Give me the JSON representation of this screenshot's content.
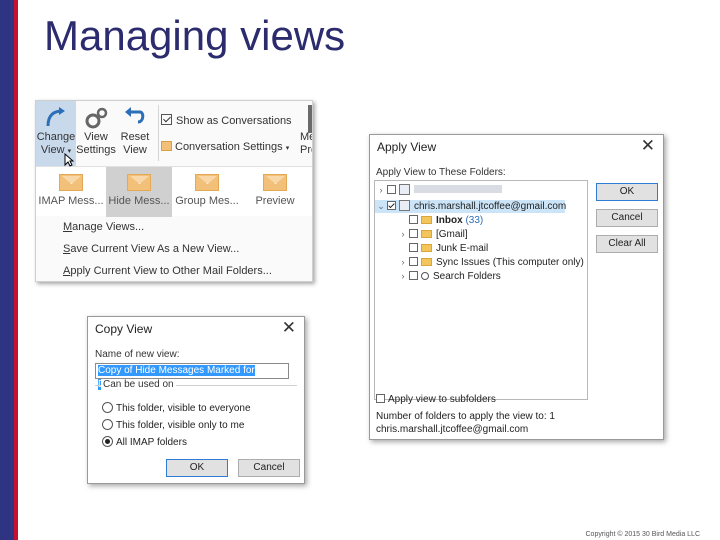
{
  "slide": {
    "title": "Managing views",
    "copyright": "Copyright © 2015 30 Bird Media LLC"
  },
  "ribbon": {
    "buttons": [
      {
        "label_line1": "Change",
        "label_line2": "View",
        "icon": "change-view-icon"
      },
      {
        "label_line1": "View",
        "label_line2": "Settings",
        "icon": "view-settings-icon"
      },
      {
        "label_line1": "Reset",
        "label_line2": "View",
        "icon": "reset-view-icon"
      }
    ],
    "show_as_conversations": "Show as Conversations",
    "conversation_settings": "Conversation Settings",
    "more_line1": "Me",
    "more_line2": "Pre",
    "gallery": [
      {
        "label": "IMAP Mess...",
        "active": false
      },
      {
        "label": "Hide Mess...",
        "active": true
      },
      {
        "label": "Group Mes...",
        "active": false
      },
      {
        "label": "Preview",
        "active": false
      }
    ],
    "menu": [
      {
        "pre": "M",
        "rest": "anage Views..."
      },
      {
        "pre": "S",
        "rest": "ave Current View As a New View..."
      },
      {
        "pre": "A",
        "rest": "pply Current View to Other Mail Folders..."
      }
    ]
  },
  "copy_view": {
    "title": "Copy View",
    "name_label": "Name of new view:",
    "name_value": "Copy of Hide Messages Marked for Deletion",
    "can_be_used_on": "Can be used on",
    "options": [
      {
        "label": "This folder, visible to everyone",
        "selected": false
      },
      {
        "label": "This folder, visible only to me",
        "selected": false
      },
      {
        "label": "All IMAP folders",
        "selected": true
      }
    ],
    "ok": "OK",
    "cancel": "Cancel"
  },
  "apply_view": {
    "title": "Apply View",
    "label": "Apply View to These Folders:",
    "account": "chris.marshall.jtcoffee@gmail.com",
    "folders": [
      {
        "name": "Inbox",
        "count": "(33)",
        "bold": true
      },
      {
        "name": "[Gmail]",
        "count": "",
        "bold": false
      },
      {
        "name": "Junk E-mail",
        "count": "",
        "bold": false
      },
      {
        "name": "Sync Issues (This computer only)",
        "count": "",
        "bold": false
      },
      {
        "name": "Search Folders",
        "count": "",
        "bold": false
      }
    ],
    "ok": "OK",
    "cancel": "Cancel",
    "clear_all": "Clear All",
    "apply_subfolders": "Apply view to subfolders",
    "count_label": "Number of folders to apply the view to: 1",
    "account_footer": "chris.marshall.jtcoffee@gmail.com"
  },
  "colors": {
    "title": "#2b2b6e",
    "bar_blue": "#2f3482",
    "bar_red": "#c8102e",
    "selection": "#3399ff"
  }
}
